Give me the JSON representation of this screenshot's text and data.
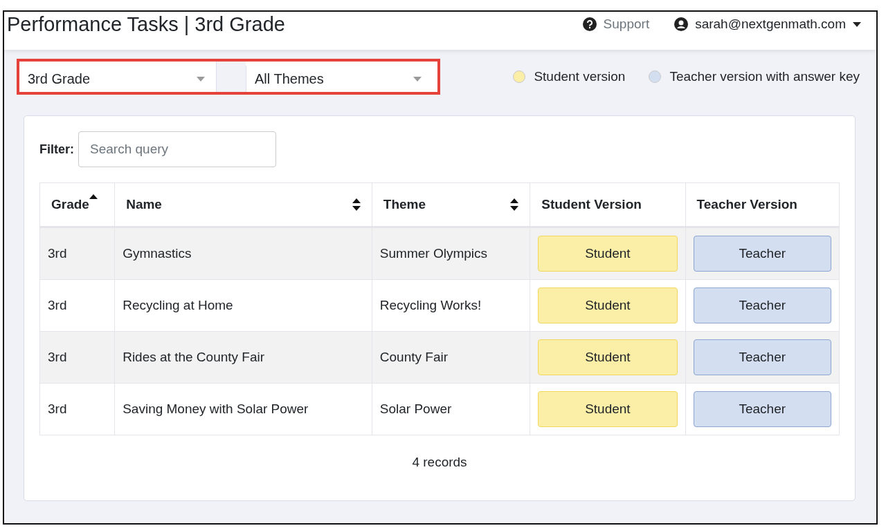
{
  "header": {
    "title": "Performance Tasks | 3rd Grade",
    "support": "Support",
    "user": "sarah@nextgenmath.com"
  },
  "selects": [
    {
      "value": "3rd Grade"
    },
    {
      "value": "All Themes"
    }
  ],
  "legend": [
    {
      "label": "Student version",
      "color": "#fbeea6"
    },
    {
      "label": "Teacher version with answer key",
      "color": "#d3def0"
    }
  ],
  "filter": {
    "label": "Filter:",
    "placeholder": "Search query"
  },
  "table": {
    "columns": [
      {
        "label": "Grade",
        "sortable": true,
        "selected": true
      },
      {
        "label": "Name",
        "sortable": true,
        "selected": false
      },
      {
        "label": "Theme",
        "sortable": true,
        "selected": false
      },
      {
        "label": "Student Version",
        "sortable": false,
        "selected": false
      },
      {
        "label": "Teacher Version",
        "sortable": false,
        "selected": false
      }
    ],
    "rows": [
      {
        "grade": "3rd",
        "name": "Gymnastics",
        "theme": "Summer Olympics",
        "student": "Student",
        "teacher": "Teacher"
      },
      {
        "grade": "3rd",
        "name": "Recycling at Home",
        "theme": "Recycling Works!",
        "student": "Student",
        "teacher": "Teacher"
      },
      {
        "grade": "3rd",
        "name": "Rides at the County Fair",
        "theme": "County Fair",
        "student": "Student",
        "teacher": "Teacher"
      },
      {
        "grade": "3rd",
        "name": "Saving Money with Solar Power",
        "theme": "Solar Power",
        "student": "Student",
        "teacher": "Teacher"
      }
    ]
  },
  "records": "4 records"
}
